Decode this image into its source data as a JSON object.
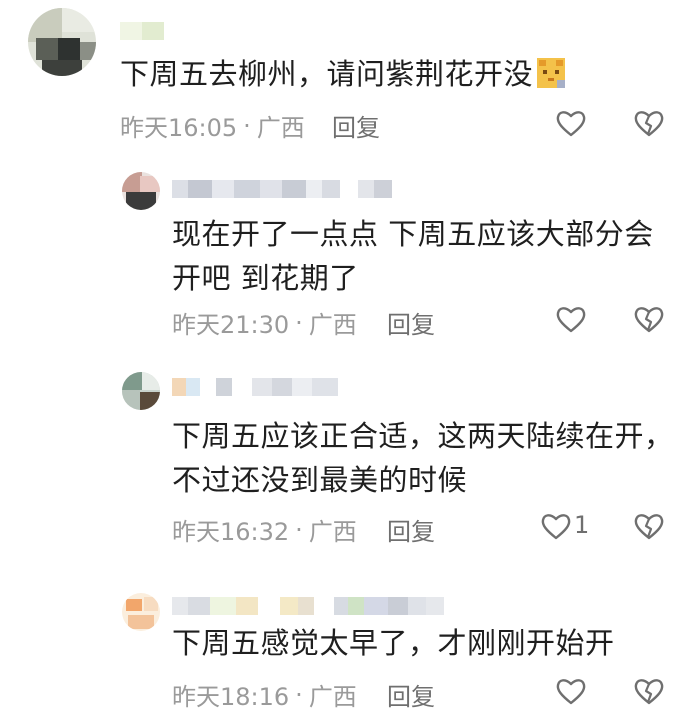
{
  "comments": [
    {
      "text": "下周五去柳州，请问紫荆花开没",
      "time": "昨天16:05",
      "location": "广西",
      "reply_label": "回复",
      "likes": ""
    },
    {
      "text_line1": "现在开了一点点 下周五应该大部分会",
      "text_line2": "开吧  到花期了",
      "time": "昨天21:30",
      "location": "广西",
      "reply_label": "回复",
      "likes": ""
    },
    {
      "text_line1": "下周五应该正合适，这两天陆续在开，",
      "text_line2": "不过还没到最美的时候",
      "time": "昨天16:32",
      "location": "广西",
      "reply_label": "回复",
      "likes": "1"
    },
    {
      "text": "下周五感觉太早了，才刚刚开始开",
      "time": "昨天18:16",
      "location": "广西",
      "reply_label": "回复",
      "likes": ""
    }
  ],
  "separator": "·",
  "icons": {
    "like": "heart-outline-icon",
    "dislike": "broken-heart-icon",
    "emoji": "cat-emoji-icon"
  },
  "colors": {
    "text": "#1f1f1f",
    "meta": "#9a9a9a",
    "icon": "#6f6f6f"
  }
}
